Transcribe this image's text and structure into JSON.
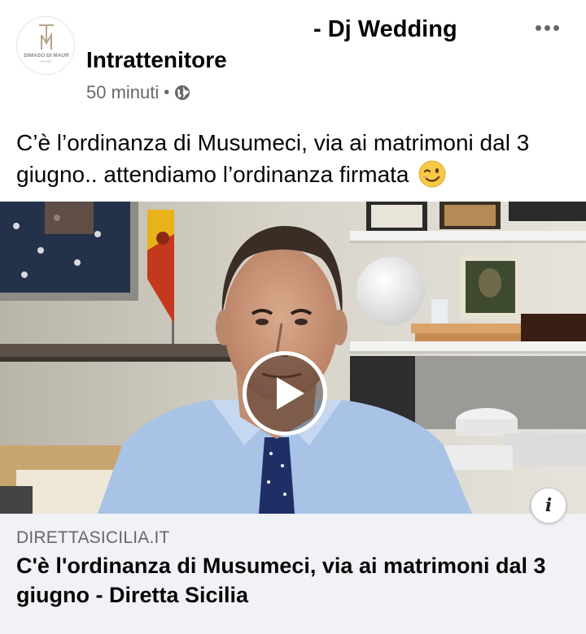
{
  "post": {
    "author_name": "- Dj Wedding",
    "author_subtitle": "Intrattenitore",
    "time": "50 minuti",
    "separator": "•",
    "privacy_icon": "globe-icon",
    "more_icon": "more-horizontal-icon",
    "avatar_logo": {
      "monogram": "TM",
      "text": "DIMASO DI MAUR",
      "subtext": "EVENTI"
    },
    "message": "C’è l’ordinanza di Musumeci, via ai matrimoni dal 3 giugno.. attendiamo l’ordinanza firmata",
    "message_emoji": "winking-face-emoji"
  },
  "video": {
    "play_icon": "play-icon",
    "info_label": "i"
  },
  "link_preview": {
    "domain": "DIRETTASICILIA.IT",
    "title": "C'è l'ordinanza di Musumeci, via ai matrimoni dal 3 giugno - Diretta Sicilia"
  },
  "colors": {
    "text_primary": "#050505",
    "text_secondary": "#65676b",
    "link_background": "#f0f2f5"
  }
}
